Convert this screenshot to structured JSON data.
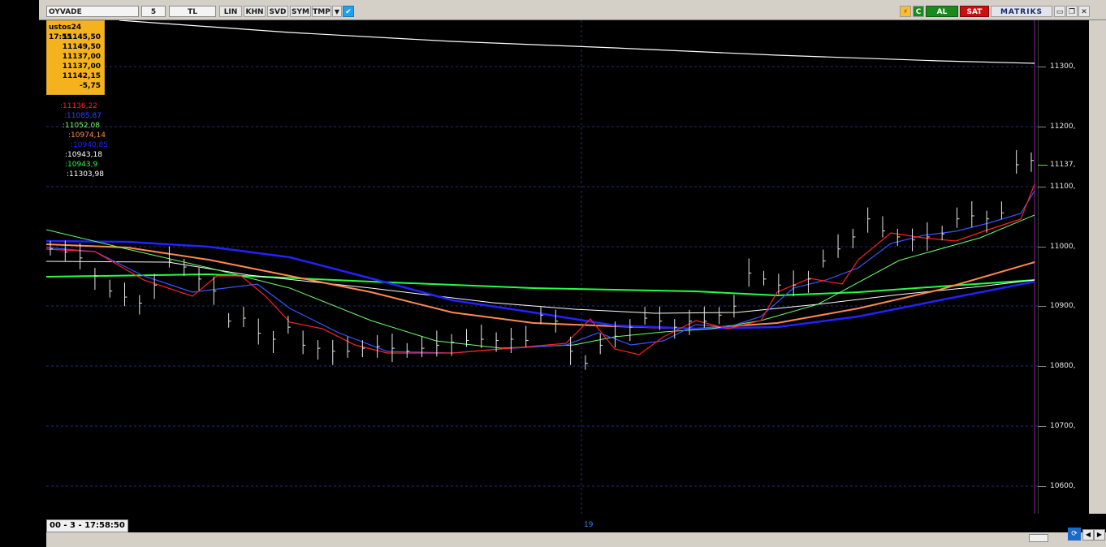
{
  "toolbar": {
    "symbol": "OYVADE",
    "period": "5",
    "currency": "TL",
    "buttons": [
      "LIN",
      "KHN",
      "SVD",
      "SYM",
      "TMP"
    ],
    "buy_label": "AL",
    "sell_label": "SAT",
    "brand": "MATRIKS"
  },
  "info_box": {
    "date": "ustos24 17:55",
    "values": [
      "11145,50",
      "11149,50",
      "11137,00",
      "11137,00",
      "11142,15",
      "-5,75"
    ]
  },
  "legend": [
    {
      "text": ":11136,22",
      "color": "#ff2020"
    },
    {
      "text": ":11085,87",
      "color": "#2a44ff"
    },
    {
      "text": ":11052,08",
      "color": "#6cff6c"
    },
    {
      "text": ":10974,14",
      "color": "#ff8a50"
    },
    {
      "text": ":10940,85",
      "color": "#2222ff"
    },
    {
      "text": ":10943,18",
      "color": "#ffffff"
    },
    {
      "text": ":10943,9",
      "color": "#22ff44"
    },
    {
      "text": ":11303,98",
      "color": "#ffffff"
    }
  ],
  "price_axis": {
    "labels": [
      {
        "text": "11300,",
        "value": 11300
      },
      {
        "text": "11200,",
        "value": 11200
      },
      {
        "text": "11137,",
        "value": 11137
      },
      {
        "text": "11100,",
        "value": 11100
      },
      {
        "text": "11000,",
        "value": 11000
      },
      {
        "text": "10900,",
        "value": 10900
      },
      {
        "text": "10800,",
        "value": 10800
      },
      {
        "text": "10700,",
        "value": 10700
      },
      {
        "text": "10600,",
        "value": 10600
      }
    ]
  },
  "status": {
    "timestamp": "00 - 3 - 17:58:50",
    "date_marker": "19"
  },
  "colors": {
    "toolbar_bg": "#d4d0c8",
    "chart_bg": "#000000",
    "info_bg": "#f4b31c",
    "buy": "#1a8a1a",
    "sell": "#cc1010"
  },
  "chart_data": {
    "type": "line",
    "ylim": [
      10550,
      11370
    ],
    "price_series": [
      [
        0,
        10990
      ],
      [
        1,
        10985
      ],
      [
        2,
        10975
      ],
      [
        3,
        10945
      ],
      [
        4,
        10920
      ],
      [
        5,
        10910
      ],
      [
        6,
        10900
      ],
      [
        7,
        10930
      ],
      [
        8,
        10970
      ],
      [
        9,
        10960
      ],
      [
        10,
        10940
      ],
      [
        11,
        10920
      ],
      [
        12,
        10870
      ],
      [
        13,
        10875
      ],
      [
        14,
        10850
      ],
      [
        15,
        10840
      ],
      [
        16,
        10860
      ],
      [
        17,
        10830
      ],
      [
        18,
        10825
      ],
      [
        19,
        10820
      ],
      [
        20,
        10820
      ],
      [
        21,
        10825
      ],
      [
        22,
        10828
      ],
      [
        23,
        10825
      ],
      [
        24,
        10820
      ],
      [
        25,
        10825
      ],
      [
        26,
        10830
      ],
      [
        27,
        10835
      ],
      [
        28,
        10838
      ],
      [
        29,
        10840
      ],
      [
        30,
        10838
      ],
      [
        31,
        10840
      ],
      [
        32,
        10838
      ],
      [
        33,
        10880
      ],
      [
        34,
        10870
      ],
      [
        35,
        10820
      ],
      [
        36,
        10800
      ],
      [
        37,
        10830
      ],
      [
        38,
        10845
      ],
      [
        39,
        10860
      ],
      [
        40,
        10875
      ],
      [
        41,
        10870
      ],
      [
        42,
        10860
      ],
      [
        43,
        10870
      ],
      [
        44,
        10870
      ],
      [
        45,
        10880
      ],
      [
        46,
        10895
      ],
      [
        47,
        10950
      ],
      [
        48,
        10940
      ],
      [
        49,
        10930
      ],
      [
        50,
        10930
      ],
      [
        51,
        10940
      ],
      [
        52,
        10970
      ],
      [
        53,
        10990
      ],
      [
        54,
        11010
      ],
      [
        55,
        11040
      ],
      [
        56,
        11020
      ],
      [
        57,
        11010
      ],
      [
        58,
        11005
      ],
      [
        59,
        11010
      ],
      [
        60,
        11015
      ],
      [
        61,
        11040
      ],
      [
        62,
        11045
      ],
      [
        63,
        11040
      ],
      [
        64,
        11050
      ],
      [
        65,
        11130
      ],
      [
        66,
        11137
      ]
    ]
  }
}
